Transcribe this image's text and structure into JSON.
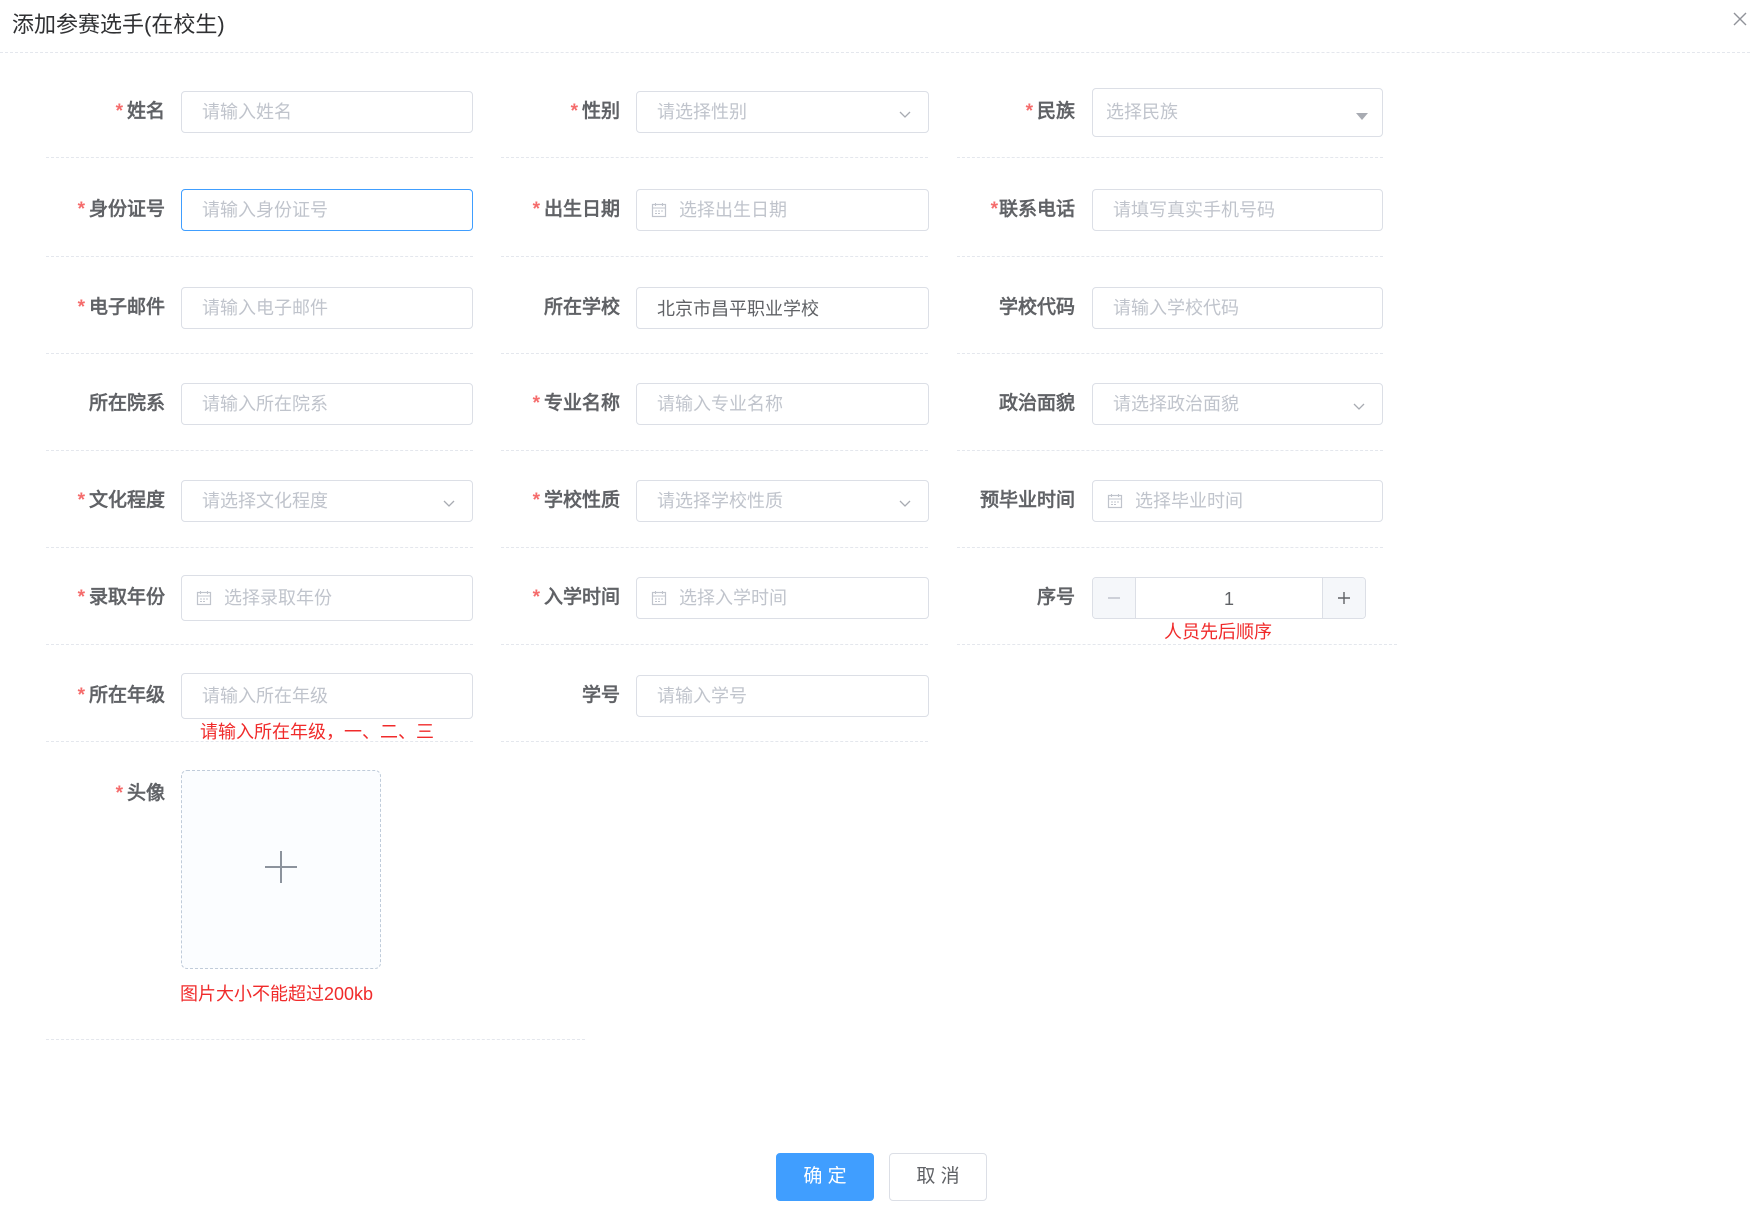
{
  "dialog": {
    "title": "添加参赛选手(在校生)",
    "close_icon": "close-icon"
  },
  "required_mark": "*",
  "fields": {
    "name": {
      "label": "姓名",
      "required": true,
      "placeholder": "请输入姓名"
    },
    "gender": {
      "label": "性别",
      "required": true,
      "placeholder": "请选择性别",
      "icon": "chevron-down-icon"
    },
    "ethnicity": {
      "label": "民族",
      "required": true,
      "placeholder": "选择民族",
      "icon": "caret-down-icon"
    },
    "id_number": {
      "label": "身份证号",
      "required": true,
      "placeholder": "请输入身份证号",
      "focused": true
    },
    "birth_date": {
      "label": "出生日期",
      "required": true,
      "placeholder": "选择出生日期",
      "icon": "calendar-icon"
    },
    "phone": {
      "label": "联系电话",
      "required": true,
      "placeholder": "请填写真实手机号码"
    },
    "email": {
      "label": "电子邮件",
      "required": true,
      "placeholder": "请输入电子邮件"
    },
    "school": {
      "label": "所在学校",
      "required": false,
      "value": "北京市昌平职业学校"
    },
    "school_code": {
      "label": "学校代码",
      "required": false,
      "placeholder": "请输入学校代码"
    },
    "department": {
      "label": "所在院系",
      "required": false,
      "placeholder": "请输入所在院系"
    },
    "major": {
      "label": "专业名称",
      "required": true,
      "placeholder": "请输入专业名称"
    },
    "political_status": {
      "label": "政治面貌",
      "required": false,
      "placeholder": "请选择政治面貌",
      "icon": "chevron-down-icon"
    },
    "education": {
      "label": "文化程度",
      "required": true,
      "placeholder": "请选择文化程度",
      "icon": "chevron-down-icon"
    },
    "school_type": {
      "label": "学校性质",
      "required": true,
      "placeholder": "请选择学校性质",
      "icon": "chevron-down-icon"
    },
    "graduation_time": {
      "label": "预毕业时间",
      "required": false,
      "placeholder": "选择毕业时间",
      "icon": "calendar-icon"
    },
    "admission_year": {
      "label": "录取年份",
      "required": true,
      "placeholder": "选择录取年份",
      "icon": "calendar-icon"
    },
    "enrollment_time": {
      "label": "入学时间",
      "required": true,
      "placeholder": "选择入学时间",
      "icon": "calendar-icon"
    },
    "sequence": {
      "label": "序号",
      "required": false,
      "value": "1",
      "hint": "人员先后顺序"
    },
    "grade": {
      "label": "所在年级",
      "required": true,
      "placeholder": "请输入所在年级",
      "hint": "请输入所在年级，一、二、三"
    },
    "student_id": {
      "label": "学号",
      "required": false,
      "placeholder": "请输入学号"
    },
    "avatar": {
      "label": "头像",
      "required": true,
      "icon": "plus-icon",
      "hint": "图片大小不能超过200kb"
    }
  },
  "buttons": {
    "confirm": "确 定",
    "cancel": "取 消"
  },
  "colors": {
    "primary": "#409eff",
    "required_mark": "#f56c6c",
    "hint_text": "#f02b2b",
    "label_text": "#606266",
    "placeholder": "#c0c4cc",
    "border": "#dcdfe6"
  }
}
